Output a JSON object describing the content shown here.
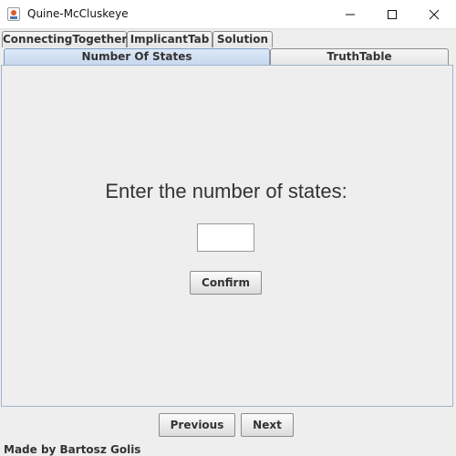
{
  "window": {
    "title": "Quine-McCluskeye",
    "icon": "java-app-icon",
    "controls": [
      "minimize-icon",
      "maximize-icon",
      "close-icon"
    ]
  },
  "tabs": {
    "row_top": [
      {
        "label": "ConnectingTogether"
      },
      {
        "label": "ImplicantTab"
      },
      {
        "label": "Solution"
      }
    ],
    "row_bottom": [
      {
        "label": "Number Of States",
        "selected": true
      },
      {
        "label": "TruthTable",
        "selected": false
      }
    ]
  },
  "main": {
    "prompt": "Enter the number of states:",
    "states_input": {
      "value": "",
      "placeholder": ""
    },
    "confirm_label": "Confirm"
  },
  "footer": {
    "previous_label": "Previous",
    "next_label": "Next",
    "credit": "Made by Bartosz Golis"
  },
  "colors": {
    "background": "#eeeeee",
    "selected_tab": "#c6d7ee",
    "panel_border": "#9fb3cc"
  }
}
